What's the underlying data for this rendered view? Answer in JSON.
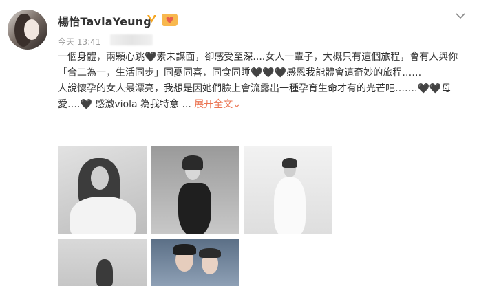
{
  "author": {
    "name": "楊怡TaviaYeung",
    "verified_icon": "verified-v-icon",
    "member_icon": "heart-badge-icon"
  },
  "time": "今天 13:41",
  "post": {
    "para1": "一個身體，兩顆心跳🖤素未謀面，卻感受至深....女人一輩子，大概只有這個旅程，會有人與你「合二為一，生活同步」同憂同喜，同食同睡🖤🖤🖤感恩我能體會這奇妙的旅程……",
    "para2": "人說懷孕的女人最漂亮，我想是因她們臉上會流露出一種孕育生命才有的光芒吧…….🖤🖤母愛….🖤 感激viola 為我特意 ... ",
    "expand_label": "展开全文",
    "expand_arrow": "⌄"
  },
  "menu_icon": "chevron-down-icon"
}
